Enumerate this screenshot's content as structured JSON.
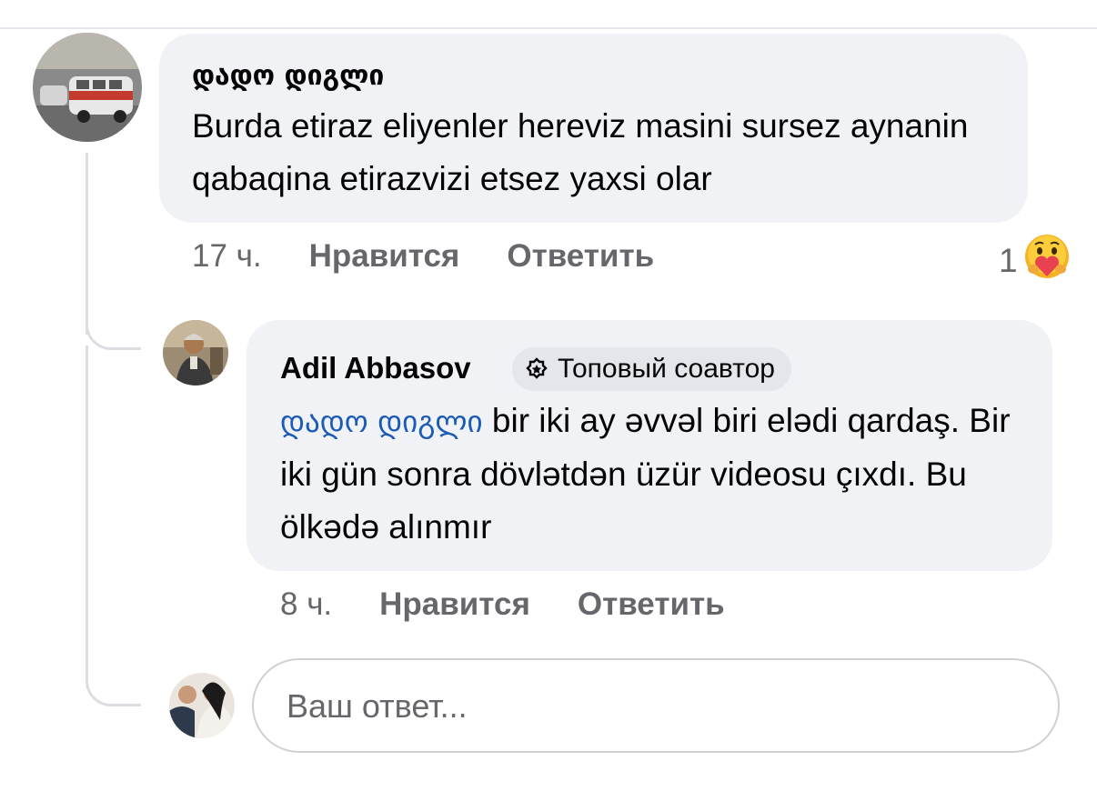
{
  "comment": {
    "author": "დადო დიგლი",
    "text": "Burda etiraz eliyenler hereviz masini sursez aynanin qabaqina etirazvizi etsez yaxsi olar",
    "time": "17 ч.",
    "like_label": "Нравится",
    "reply_label": "Ответить",
    "reaction_count": "1",
    "reaction_icon": "care-emoji-icon"
  },
  "reply": {
    "author": "Adil Abbasov",
    "badge": "Топовый соавтор",
    "mention": "დადო დიგლი",
    "text": " bir iki ay əvvəl biri elədi qardaş. Bir iki gün sonra dövlətdən üzür videosu çıxdı. Bu ölkədə alınmır",
    "time": "8 ч.",
    "like_label": "Нравится",
    "reply_label": "Ответить"
  },
  "reply_box": {
    "placeholder": "Ваш ответ..."
  },
  "colors": {
    "bubble": "#f0f2f5",
    "mention": "#1b5bb5",
    "meta": "#65676b",
    "thread_line": "#dadde1"
  }
}
